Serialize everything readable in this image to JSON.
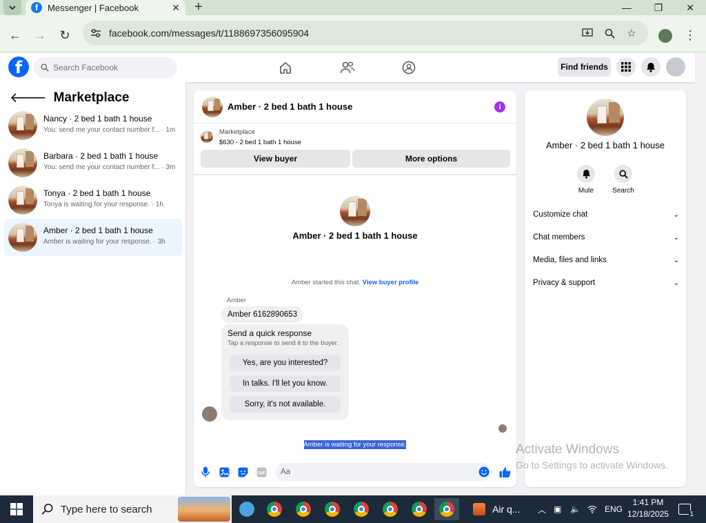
{
  "browser": {
    "tab_title": "Messenger | Facebook",
    "url": "facebook.com/messages/t/1188697356095904"
  },
  "fb": {
    "search_placeholder": "Search Facebook",
    "find_friends": "Find friends"
  },
  "marketplace": {
    "title": "Marketplace",
    "conversations": [
      {
        "name": "Nancy · 2 bed 1 bath 1 house",
        "preview": "You: send me your contact number f... · 1m"
      },
      {
        "name": "Barbara · 2 bed 1 bath 1 house",
        "preview": "You: send me your contact number f... · 3m"
      },
      {
        "name": "Tonya · 2 bed 1 bath 1 house",
        "preview": "Tonya is waiting for your response. · 1h"
      },
      {
        "name": "Amber · 2 bed 1 bath 1 house",
        "preview": "Amber is waiting for your response. · 3h"
      }
    ]
  },
  "chat": {
    "title": "Amber · 2 bed 1 bath 1 house",
    "listing_source": "Marketplace",
    "listing_title": "$630 - 2 bed 1 bath 1 house",
    "view_buyer": "View buyer",
    "more_options": "More options",
    "profile_name": "Amber · 2 bed 1 bath 1 house",
    "started_text": "Amber started this chat.",
    "view_buyer_profile": "View buyer profile",
    "sender": "Amber",
    "message": "Amber 6162890653",
    "quick_title": "Send a quick response",
    "quick_sub": "Tap a response to send it to the buyer.",
    "quick_options": [
      "Yes, are you interested?",
      "In talks. I'll let you know.",
      "Sorry, it's not available."
    ],
    "waiting": "Amber is waiting for your response.",
    "composer_placeholder": "Aa"
  },
  "info": {
    "name": "Amber · 2 bed 1 bath 1 house",
    "mute": "Mute",
    "search": "Search",
    "sections": [
      "Customize chat",
      "Chat members",
      "Media, files and links",
      "Privacy & support"
    ]
  },
  "watermark": {
    "line1": "Activate Windows",
    "line2": "Go to Settings to activate Windows."
  },
  "taskbar": {
    "search_placeholder": "Type here to search",
    "weather": "Air q...",
    "lang": "ENG",
    "time": "1:41 PM",
    "date": "12/18/2025",
    "notif_count": "1"
  },
  "colors": {
    "fb_blue": "#0866ff",
    "selected_row": "#ebf5ff",
    "info_icon": "#a033ff",
    "selection_highlight": "#3b64d6"
  }
}
